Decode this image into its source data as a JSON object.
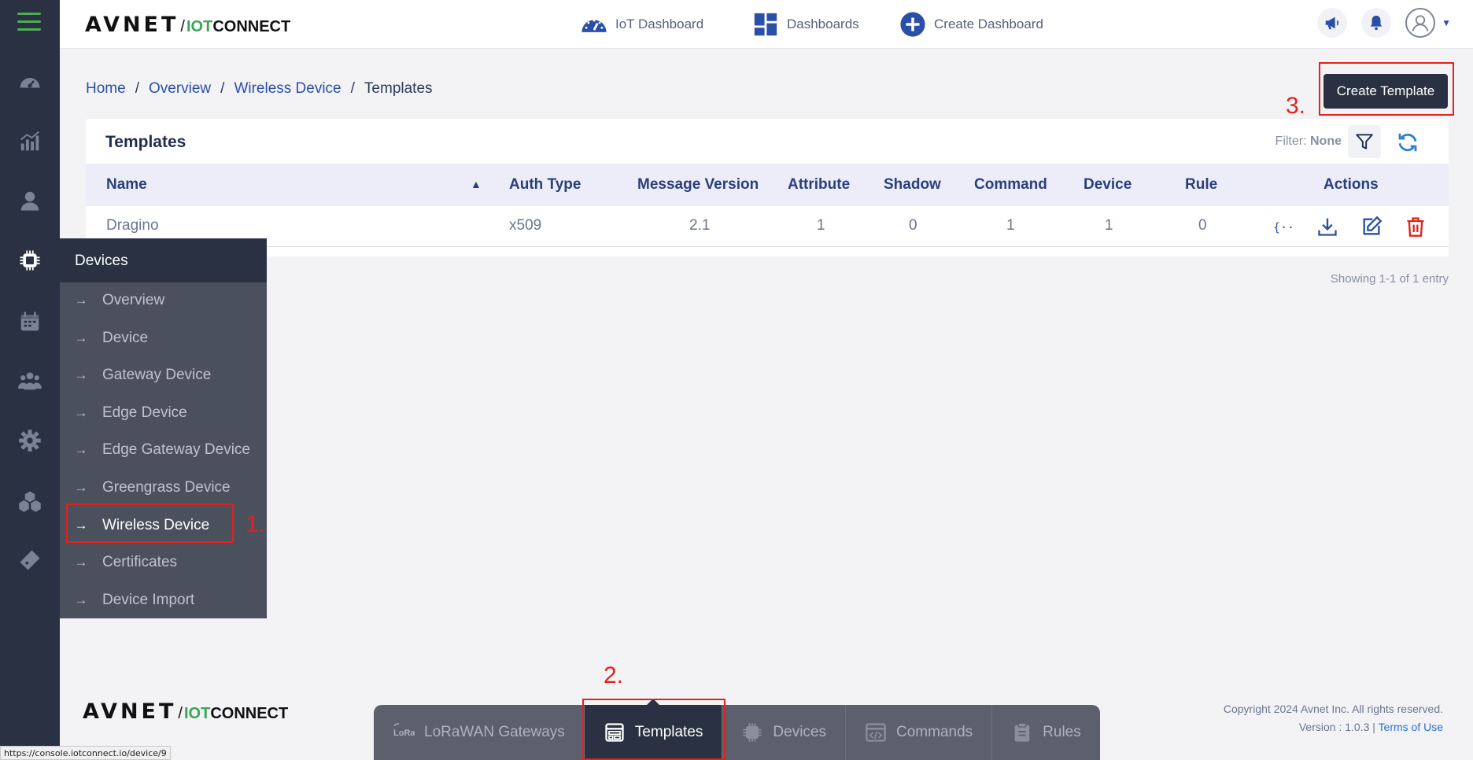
{
  "header": {
    "logo": {
      "brand": "AVNET",
      "slash": "/",
      "iot": "IOT",
      "connect": "CONNECT"
    },
    "nav": [
      {
        "label": "IoT Dashboard",
        "icon": "speedometer-icon"
      },
      {
        "label": "Dashboards",
        "icon": "dashboard-grid-icon"
      },
      {
        "label": "Create Dashboard",
        "icon": "plus-circle-icon"
      }
    ],
    "icons": [
      "megaphone-icon",
      "bell-icon",
      "user-avatar-icon",
      "caret-down-icon"
    ]
  },
  "breadcrumb": [
    {
      "label": "Home"
    },
    {
      "label": "Overview"
    },
    {
      "label": "Wireless Device"
    },
    {
      "label": "Templates"
    }
  ],
  "create_button": {
    "label": "Create Template"
  },
  "annotations": {
    "one": "1.",
    "two": "2.",
    "three": "3."
  },
  "card": {
    "title": "Templates",
    "filter_label": "Filter:",
    "filter_value": "None",
    "columns": [
      "Name",
      "Auth Type",
      "Message Version",
      "Attribute",
      "Shadow",
      "Command",
      "Device",
      "Rule",
      "Actions"
    ],
    "rows": [
      {
        "name": "Dragino",
        "auth_type": "x509",
        "message_version": "2.1",
        "attribute": "1",
        "shadow": "0",
        "command": "1",
        "device": "1",
        "rule": "0"
      }
    ],
    "showing": "Showing 1-1 of 1 entry"
  },
  "flyout": {
    "title": "Devices",
    "items": [
      {
        "label": "Overview"
      },
      {
        "label": "Device"
      },
      {
        "label": "Gateway Device"
      },
      {
        "label": "Edge Device"
      },
      {
        "label": "Edge Gateway Device"
      },
      {
        "label": "Greengrass Device"
      },
      {
        "label": "Wireless Device",
        "active": true
      },
      {
        "label": "Certificates"
      },
      {
        "label": "Device Import"
      }
    ]
  },
  "footer": {
    "copyright": "Copyright 2024 Avnet Inc. All rights reserved.",
    "version": "Version : 1.0.3 |",
    "terms": "Terms of Use"
  },
  "bottom_bar": [
    {
      "label": "LoRaWAN Gateways",
      "icon": "lora-icon"
    },
    {
      "label": "Templates",
      "icon": "template-icon",
      "active": true
    },
    {
      "label": "Devices",
      "icon": "chip-icon"
    },
    {
      "label": "Commands",
      "icon": "code-window-icon"
    },
    {
      "label": "Rules",
      "icon": "clipboard-icon"
    }
  ],
  "status_url": "https://console.iotconnect.io/device/9",
  "colors": {
    "accent": "#2a4fa8",
    "rail": "#2a3142",
    "annotation": "#e2211c",
    "danger": "#e2211c"
  }
}
